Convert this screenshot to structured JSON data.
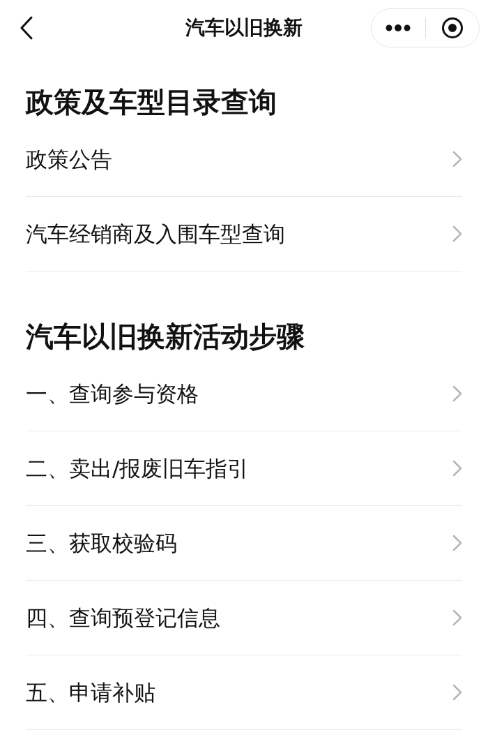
{
  "nav_bar": {
    "title": "汽车以旧换新"
  },
  "sections": [
    {
      "title": "政策及车型目录查询",
      "items": [
        {
          "label": "政策公告"
        },
        {
          "label": "汽车经销商及入围车型查询"
        }
      ]
    },
    {
      "title": "汽车以旧换新活动步骤",
      "items": [
        {
          "label": "一、查询参与资格"
        },
        {
          "label": "二、卖出/报废旧车指引"
        },
        {
          "label": "三、获取校验码"
        },
        {
          "label": "四、查询预登记信息"
        },
        {
          "label": "五、申请补贴"
        }
      ]
    }
  ]
}
